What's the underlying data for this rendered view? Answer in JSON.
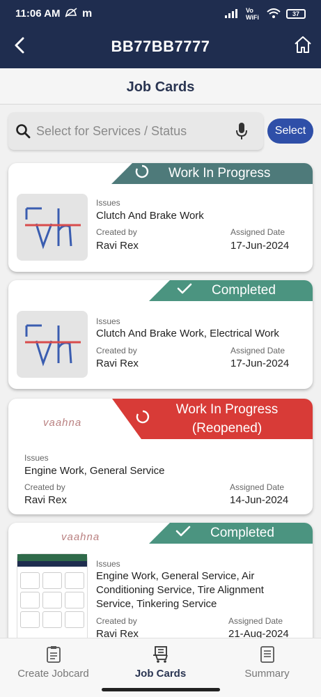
{
  "status_bar": {
    "time": "11:06 AM",
    "app_letter": "m",
    "network": "Vo WiFi",
    "battery": "37"
  },
  "header": {
    "title": "BB77BB7777"
  },
  "page": {
    "title": "Job Cards"
  },
  "search": {
    "placeholder": "Select for Services / Status"
  },
  "select_button": "Select",
  "cards": [
    {
      "status": "Work In Progress",
      "issues_label": "Issues",
      "issues": "Clutch And Brake Work",
      "created_by_label": "Created by",
      "created_by": "Ravi Rex",
      "assigned_label": "Assigned Date",
      "assigned_date": "17-Jun-2024"
    },
    {
      "status": "Completed",
      "issues_label": "Issues",
      "issues": "Clutch And Brake Work, Electrical Work",
      "created_by_label": "Created by",
      "created_by": "Ravi Rex",
      "assigned_label": "Assigned Date",
      "assigned_date": "17-Jun-2024"
    },
    {
      "status_line1": "Work In Progress",
      "status_line2": "(Reopened)",
      "logo": "vaahna",
      "issues_label": "Issues",
      "issues": "Engine Work, General Service",
      "created_by_label": "Created by",
      "created_by": "Ravi Rex",
      "assigned_label": "Assigned Date",
      "assigned_date": "14-Jun-2024"
    },
    {
      "status": "Completed",
      "logo": "vaahna",
      "issues_label": "Issues",
      "issues_line1": "Engine Work, General Service, Air",
      "issues_line2": "Conditioning Service, Tire Alignment",
      "issues_line3": "Service, Tinkering Service",
      "created_by_label": "Created by",
      "created_by": "Ravi Rex",
      "assigned_label": "Assigned Date",
      "assigned_date": "21-Aug-2024"
    }
  ],
  "bottom_nav": [
    {
      "label": "Create Jobcard"
    },
    {
      "label": "Job Cards"
    },
    {
      "label": "Summary"
    }
  ],
  "colors": {
    "header": "#1f2d4f",
    "wip": "#4e7a7a",
    "completed": "#4b9480",
    "reopened": "#d83b37",
    "select": "#2f4fa8"
  }
}
